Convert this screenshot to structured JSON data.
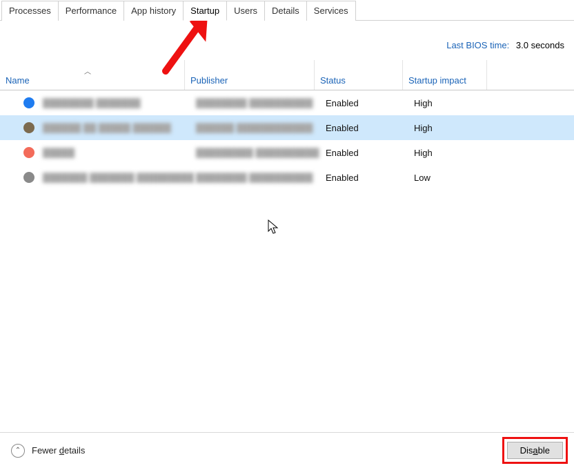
{
  "tabs": [
    {
      "label": "Processes",
      "active": false
    },
    {
      "label": "Performance",
      "active": false
    },
    {
      "label": "App history",
      "active": false
    },
    {
      "label": "Startup",
      "active": true
    },
    {
      "label": "Users",
      "active": false
    },
    {
      "label": "Details",
      "active": false
    },
    {
      "label": "Services",
      "active": false
    }
  ],
  "bios": {
    "label": "Last BIOS time:",
    "value": "3.0 seconds"
  },
  "columns": {
    "name": "Name",
    "publisher": "Publisher",
    "status": "Status",
    "impact": "Startup impact"
  },
  "rows": [
    {
      "icon_color": "#1f7cf0",
      "name_blur": "████████ ███████",
      "pub_blur": "████████ ██████████",
      "status": "Enabled",
      "impact": "High",
      "selected": false
    },
    {
      "icon_color": "#7c6a4f",
      "name_blur": "██████ ██ █████ ██████",
      "pub_blur": "██████ ████████████",
      "status": "Enabled",
      "impact": "High",
      "selected": true
    },
    {
      "icon_color": "#f36b5a",
      "name_blur": "█████",
      "pub_blur": "█████████ ██████████",
      "status": "Enabled",
      "impact": "High",
      "selected": false
    },
    {
      "icon_color": "#8a8a8a",
      "name_blur": "███████ ███████ █████████",
      "pub_blur": "████████ ██████████",
      "status": "Enabled",
      "impact": "Low",
      "selected": false
    }
  ],
  "footer": {
    "fewer": "Fewer details",
    "disable": "Disable"
  }
}
